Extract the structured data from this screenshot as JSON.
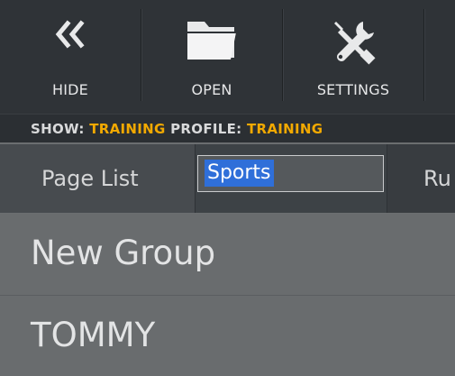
{
  "toolbar": {
    "hide_label": "HIDE",
    "open_label": "OPEN",
    "settings_label": "SETTINGS"
  },
  "status": {
    "show_prefix": "SHOW:",
    "show_value": "TRAINING",
    "profile_prefix": "PROFILE:",
    "profile_value": "TRAINING"
  },
  "tabs": {
    "page_list": "Page List",
    "editing_tab_value": "Sports",
    "next_tab_partial": "Ru"
  },
  "list": {
    "items": [
      "New Group",
      "TOMMY"
    ]
  },
  "colors": {
    "accent": "#f2a900",
    "selection": "#2f6fd9"
  },
  "icons": {
    "hide": "double-chevron-left-icon",
    "open": "folder-icon",
    "settings": "wrench-screwdriver-icon"
  }
}
